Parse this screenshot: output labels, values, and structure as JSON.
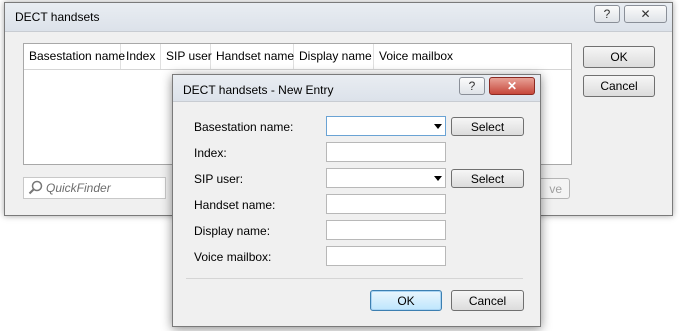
{
  "main_window": {
    "title": "DECT handsets",
    "help_glyph": "?",
    "close_glyph": "✕",
    "columns": [
      "Basestation name",
      "Index",
      "SIP user",
      "Handset name",
      "Display name",
      "Voice mailbox"
    ],
    "ok_label": "OK",
    "cancel_label": "Cancel",
    "quickfinder_placeholder": "QuickFinder",
    "partial_button_label": "ve"
  },
  "dialog": {
    "title": "DECT handsets - New Entry",
    "help_glyph": "?",
    "close_glyph": "✕",
    "fields": {
      "basestation_label": "Basestation name:",
      "index_label": "Index:",
      "sip_user_label": "SIP user:",
      "handset_name_label": "Handset name:",
      "display_name_label": "Display name:",
      "voice_mailbox_label": "Voice mailbox:"
    },
    "values": {
      "basestation": "",
      "index": "",
      "sip_user": "",
      "handset_name": "",
      "display_name": "",
      "voice_mailbox": ""
    },
    "select_label": "Select",
    "ok_label": "OK",
    "cancel_label": "Cancel"
  },
  "icons": {
    "search": "magnifier-icon"
  }
}
